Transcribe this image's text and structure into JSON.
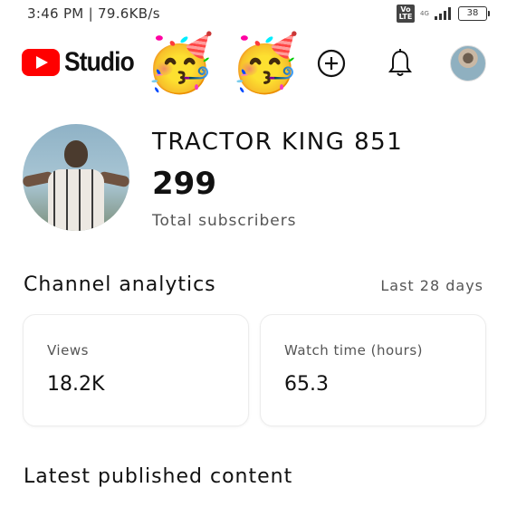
{
  "status_bar": {
    "time": "3:46 PM | 79.6KB/s",
    "volte": "Vo LTE",
    "network": "4G",
    "battery": "38"
  },
  "header": {
    "logo_text": "Studio",
    "emoji_1": "🥳",
    "emoji_2": "🥳"
  },
  "channel": {
    "name": "TRACTOR KING 851",
    "subscribers": "299",
    "subscribers_label": "Total subscribers"
  },
  "analytics": {
    "title": "Channel analytics",
    "period": "Last 28 days",
    "cards": [
      {
        "label": "Views",
        "value": "18.2K"
      },
      {
        "label": "Watch time (hours)",
        "value": "65.3"
      }
    ]
  },
  "latest": {
    "title": "Latest published content"
  },
  "colors": {
    "brand_red": "#ff0000",
    "text": "#111111",
    "muted": "#555555"
  }
}
